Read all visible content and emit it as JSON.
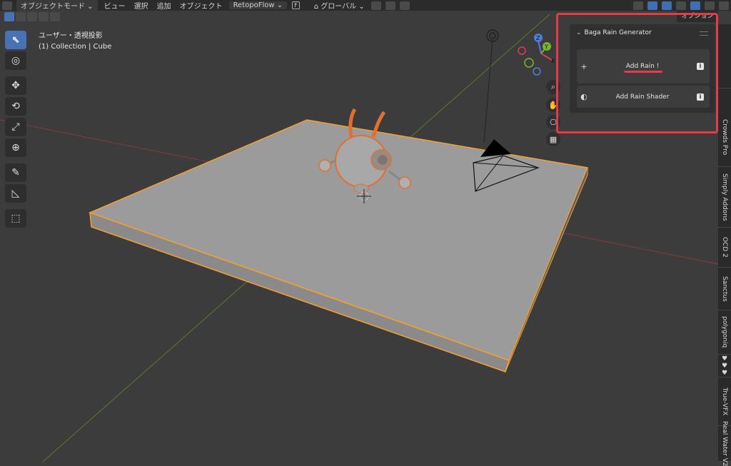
{
  "header": {
    "mode_label": "オブジェクトモード",
    "menus": [
      "ビュー",
      "選択",
      "追加",
      "オブジェクト"
    ],
    "retopoflow_label": "RetopoFlow",
    "retopoflow_badge": "F",
    "orientation_label": "グローバル"
  },
  "viewport": {
    "view_name": "ユーザー・透視投影",
    "collection_info": "(1) Collection | Cube"
  },
  "gizmo": {
    "z_label": "Z",
    "y_label": "Y",
    "x_label": "X"
  },
  "options_label": "オプション",
  "panel": {
    "title": "Baga Rain Generator",
    "add_rain_icon": "+",
    "add_rain_label": "Add Rain !",
    "add_shader_label": "Add Rain Shader",
    "info_glyph": "i"
  },
  "tabs": [
    "Crowds Pro",
    "Simply Addons",
    "OCD 2",
    "Sanctus",
    "polygoniq",
    "♥♥♥",
    "True-VFX",
    "Real Water V2"
  ],
  "colors": {
    "accent": "#4772b3",
    "highlight": "#e8394a",
    "selection": "#f5a030"
  }
}
